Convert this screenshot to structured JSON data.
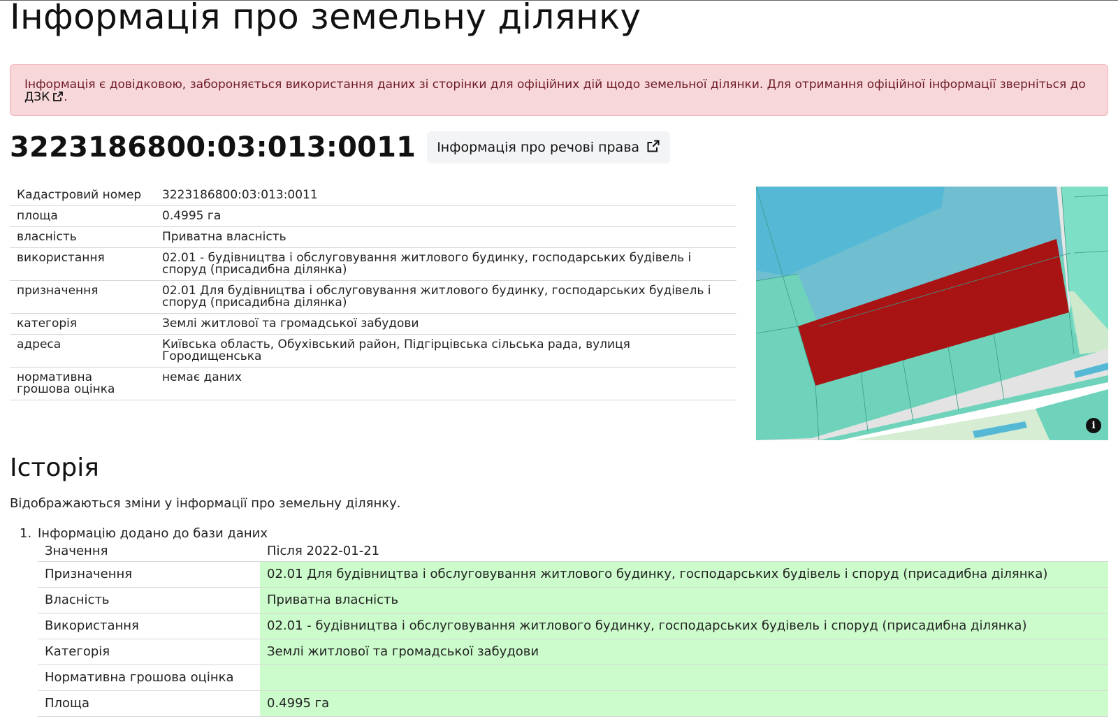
{
  "page": {
    "title": "Інформація про земельну ділянку"
  },
  "alert": {
    "text": "Інформація є довідковою, забороняється використання даних зі сторінки для офіційних дій щодо земельної ділянки. Для отримання офіційної інформації зверніться до",
    "link_label": "ДЗК",
    "end": "."
  },
  "parcel": {
    "cadastral_number": "3223186800:03:013:0011",
    "rights_button_label": "Інформація про речові права"
  },
  "properties": [
    {
      "label": "Кадастровий номер",
      "value": "3223186800:03:013:0011"
    },
    {
      "label": "площа",
      "value": "0.4995 га"
    },
    {
      "label": "власність",
      "value": "Приватна власність"
    },
    {
      "label": "використання",
      "value": "02.01 - будівництва і обслуговування житлового будинку, господарських будівель і споруд (присадибна ділянка)"
    },
    {
      "label": "призначення",
      "value": "02.01 Для будівництва і обслуговування житлового будинку, господарських будівель і споруд (присадибна ділянка)"
    },
    {
      "label": "категорія",
      "value": "Землі житлової та громадської забудови"
    },
    {
      "label": "адреса",
      "value": "Київська область, Обухівський район, Підгірцівська сільська рада, вулиця Городищенська"
    },
    {
      "label": "нормативна грошова оцінка",
      "value": "немає даних"
    }
  ],
  "map": {
    "highlight_color": "#a81414",
    "info_icon": "info-icon"
  },
  "history": {
    "title": "Історія",
    "description": "Відображаються зміни у інформації про земельну ділянку.",
    "items": [
      {
        "number": "1.",
        "title": "Інформацію додано до бази даних",
        "header": {
          "label": "Значення",
          "value": "Після 2022-01-21"
        },
        "rows": [
          {
            "label": "Призначення",
            "value": "02.01 Для будівництва і обслуговування житлового будинку, господарських будівель і споруд (присадибна ділянка)"
          },
          {
            "label": "Власність",
            "value": "Приватна власність"
          },
          {
            "label": "Використання",
            "value": "02.01 - будівництва і обслуговування житлового будинку, господарських будівель і споруд (присадибна ділянка)"
          },
          {
            "label": "Категорія",
            "value": "Землі житлової та громадської забудови"
          },
          {
            "label": "Нормативна грошова оцінка",
            "value": ""
          },
          {
            "label": "Площа",
            "value": "0.4995 га"
          }
        ]
      }
    ]
  },
  "colors": {
    "alert_bg": "#f8d7da",
    "alert_text": "#6b1a24",
    "changed_bg": "#ccfccc"
  }
}
